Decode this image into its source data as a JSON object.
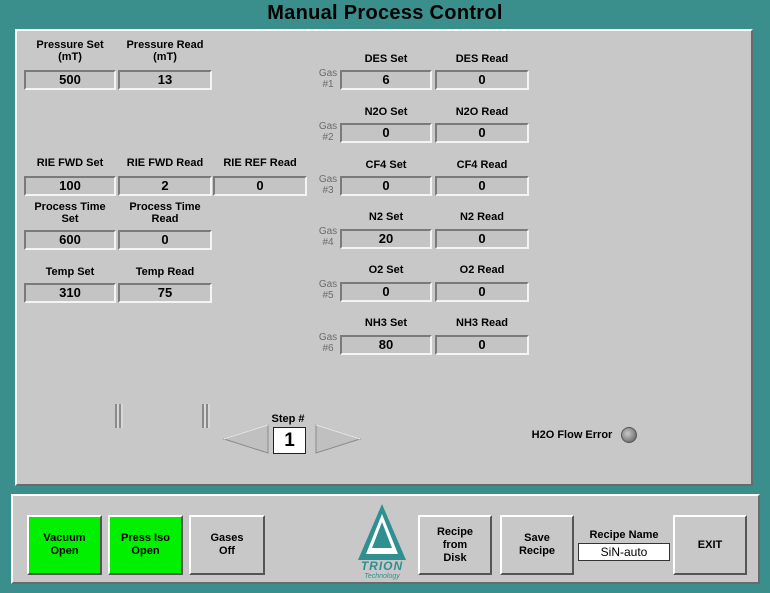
{
  "title": "Manual Process Control",
  "left_fields": [
    {
      "set_label": "Pressure Set\n(mT)",
      "set_value": "500",
      "read_label": "Pressure Read\n(mT)",
      "read_value": "13"
    },
    {
      "set_label": "RIE FWD Set",
      "set_value": "100",
      "read_label": "RIE FWD Read",
      "read_value": "2"
    },
    {
      "set_label": "Process Time\nSet",
      "set_value": "600",
      "read_label": "Process Time\nRead",
      "read_value": "0"
    },
    {
      "set_label": "Temp Set",
      "set_value": "310",
      "read_label": "Temp Read",
      "read_value": "75"
    }
  ],
  "rie_ref": {
    "label": "RIE REF Read",
    "value": "0"
  },
  "gases": [
    {
      "gas_label": "Gas\n#1",
      "set_label": "DES Set",
      "set_value": "6",
      "read_label": "DES Read",
      "read_value": "0"
    },
    {
      "gas_label": "Gas\n#2",
      "set_label": "N2O Set",
      "set_value": "0",
      "read_label": "N2O Read",
      "read_value": "0"
    },
    {
      "gas_label": "Gas\n#3",
      "set_label": "CF4 Set",
      "set_value": "0",
      "read_label": "CF4 Read",
      "read_value": "0"
    },
    {
      "gas_label": "Gas\n#4",
      "set_label": "N2 Set",
      "set_value": "20",
      "read_label": "N2 Read",
      "read_value": "0"
    },
    {
      "gas_label": "Gas\n#5",
      "set_label": "O2 Set",
      "set_value": "0",
      "read_label": "O2 Read",
      "read_value": "0"
    },
    {
      "gas_label": "Gas\n#6",
      "set_label": "NH3 Set",
      "set_value": "80",
      "read_label": "NH3 Read",
      "read_value": "0"
    }
  ],
  "step": {
    "label": "Step #",
    "value": "1"
  },
  "h2o": {
    "label": "H2O Flow Error"
  },
  "buttons": {
    "vacuum": "Vacuum\nOpen",
    "press_iso": "Press Iso\nOpen",
    "gases": "Gases\nOff",
    "recipe_from_disk": "Recipe\nfrom\nDisk",
    "save_recipe": "Save\nRecipe",
    "exit": "EXIT"
  },
  "recipe": {
    "label": "Recipe Name",
    "value": "SiN-auto"
  },
  "logo": {
    "name": "TRION",
    "sub": "Technology"
  },
  "colors": {
    "background": "#3a8e8c",
    "panel": "#c8c8c8",
    "active_button": "#00f000",
    "logo_teal": "#2f8f91"
  }
}
